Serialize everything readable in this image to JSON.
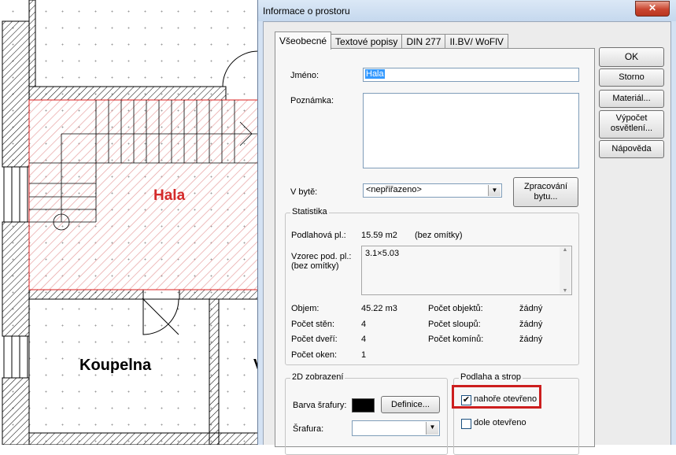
{
  "cad": {
    "rooms": {
      "hall": "Hala",
      "bathroom": "Koupelna",
      "partial": "V"
    },
    "colors": {
      "hall_label": "#d42a2a",
      "hatch": "#e7a1a1"
    }
  },
  "dialog": {
    "title": "Informace o prostoru",
    "close_label": "✕",
    "tabs": [
      "Všeobecné",
      "Textové popisy",
      "DIN 277",
      "II.BV/ WoFlV"
    ],
    "name_label": "Jméno:",
    "name_value": "Hala",
    "note_label": "Poznámka:",
    "note_value": "",
    "in_apartment_label": "V bytě:",
    "in_apartment_value": "<nepřiřazeno>",
    "process_apartment_label": "Zpracování bytu...",
    "statistics": {
      "title": "Statistika",
      "floor_area_label": "Podlahová pl.:",
      "floor_area_value": "15.59 m2",
      "floor_area_note": "(bez omítky)",
      "formula_label_1": "Vzorec pod. pl.:",
      "formula_label_2": "(bez omítky)",
      "formula_value": "3.1×5.03",
      "volume_label": "Objem:",
      "volume_value": "45.22 m3",
      "walls_label": "Počet stěn:",
      "walls_value": "4",
      "doors_label": "Počet dveří:",
      "doors_value": "4",
      "windows_label": "Počet oken:",
      "windows_value": "1",
      "objects_label": "Počet objektů:",
      "objects_value": "žádný",
      "columns_label": "Počet sloupů:",
      "columns_value": "žádný",
      "chimneys_label": "Počet komínů:",
      "chimneys_value": "žádný"
    },
    "display2d": {
      "title": "2D zobrazení",
      "hatch_color_label": "Barva šrafury:",
      "hatch_color": "#000000",
      "definition_button": "Definice...",
      "hatch_label": "Šrafura:",
      "hatch_value": ""
    },
    "floor_ceiling": {
      "title": "Podlaha a strop",
      "top_open_label": "nahoře otevřeno",
      "top_open_checked": "✔",
      "bottom_open_label": "dole otevřeno",
      "bottom_open_checked": ""
    },
    "buttons": {
      "ok": "OK",
      "cancel": "Storno",
      "material": "Materiál...",
      "lighting_1": "Výpočet",
      "lighting_2": "osvětlení...",
      "help": "Nápověda"
    }
  }
}
